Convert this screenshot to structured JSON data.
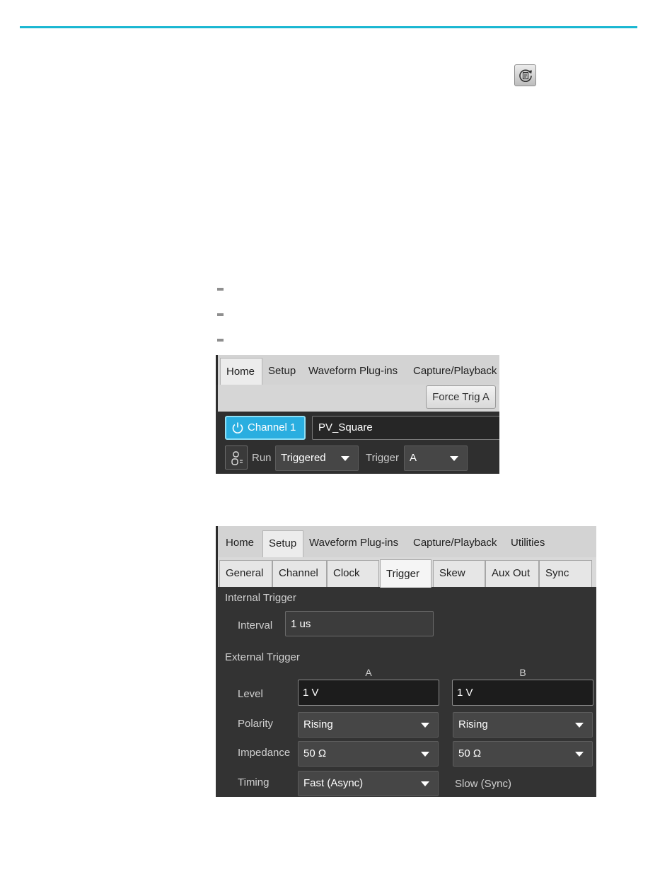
{
  "doc": {
    "accent": "#1ab7d2"
  },
  "icons": {
    "reset": "reset-defaults-icon",
    "power": "power-icon",
    "run_mode": "run-mode-icon"
  },
  "panel1": {
    "tabs": [
      {
        "label": "Home",
        "active": true
      },
      {
        "label": "Setup"
      },
      {
        "label": "Waveform Plug-ins"
      },
      {
        "label": "Capture/Playback"
      }
    ],
    "force_trig": "Force Trig A",
    "channel_button": "Channel 1",
    "waveform_name": "PV_Square",
    "run_label": "Run",
    "run_mode": "Triggered",
    "trigger_label": "Trigger",
    "trigger_value": "A"
  },
  "panel2": {
    "tabs": [
      {
        "label": "Home"
      },
      {
        "label": "Setup",
        "active": true
      },
      {
        "label": "Waveform Plug-ins"
      },
      {
        "label": "Capture/Playback"
      },
      {
        "label": "Utilities"
      }
    ],
    "subtabs": [
      {
        "label": "General"
      },
      {
        "label": "Channel"
      },
      {
        "label": "Clock"
      },
      {
        "label": "Trigger",
        "active": true
      },
      {
        "label": "Skew"
      },
      {
        "label": "Aux Out"
      },
      {
        "label": "Sync"
      }
    ],
    "internal_trigger": {
      "heading": "Internal Trigger",
      "interval_label": "Interval",
      "interval_value": "1 us"
    },
    "external_trigger": {
      "heading": "External Trigger",
      "col_a": "A",
      "col_b": "B",
      "level_label": "Level",
      "level_a": "1 V",
      "level_b": "1 V",
      "polarity_label": "Polarity",
      "polarity_a": "Rising",
      "polarity_b": "Rising",
      "impedance_label": "Impedance",
      "impedance_a": "50 Ω",
      "impedance_b": "50 Ω",
      "timing_label": "Timing",
      "timing_a": "Fast (Async)",
      "timing_b": "Slow (Sync)"
    }
  }
}
